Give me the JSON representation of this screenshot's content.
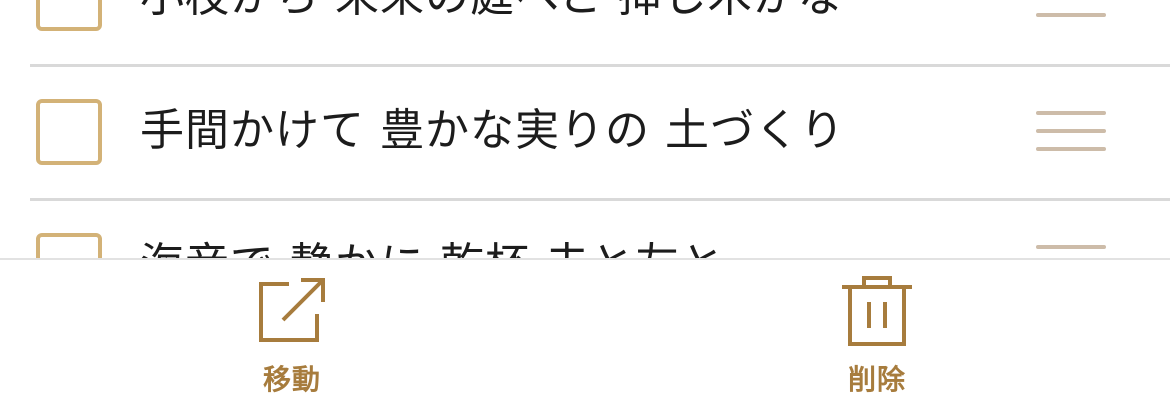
{
  "colors": {
    "accent": "#a77c3d",
    "checkbox_border": "#d3b277",
    "drag_handle": "#cdbca9",
    "divider": "#d9d9d9",
    "text": "#1c1c1c"
  },
  "list": {
    "items": [
      {
        "text": "小枝から 未来の庭へと 挿し木かな",
        "checked": false,
        "icon": "drag-handle-icon"
      },
      {
        "text": "手間かけて 豊かな実りの 土づくり",
        "checked": false,
        "icon": "drag-handle-icon"
      },
      {
        "text": "海音で 静かに 乾杯 夫と友と",
        "checked": false,
        "icon": "drag-handle-icon"
      }
    ]
  },
  "toolbar": {
    "move": {
      "label": "移動",
      "icon": "share-icon"
    },
    "delete": {
      "label": "削除",
      "icon": "trash-icon"
    }
  }
}
